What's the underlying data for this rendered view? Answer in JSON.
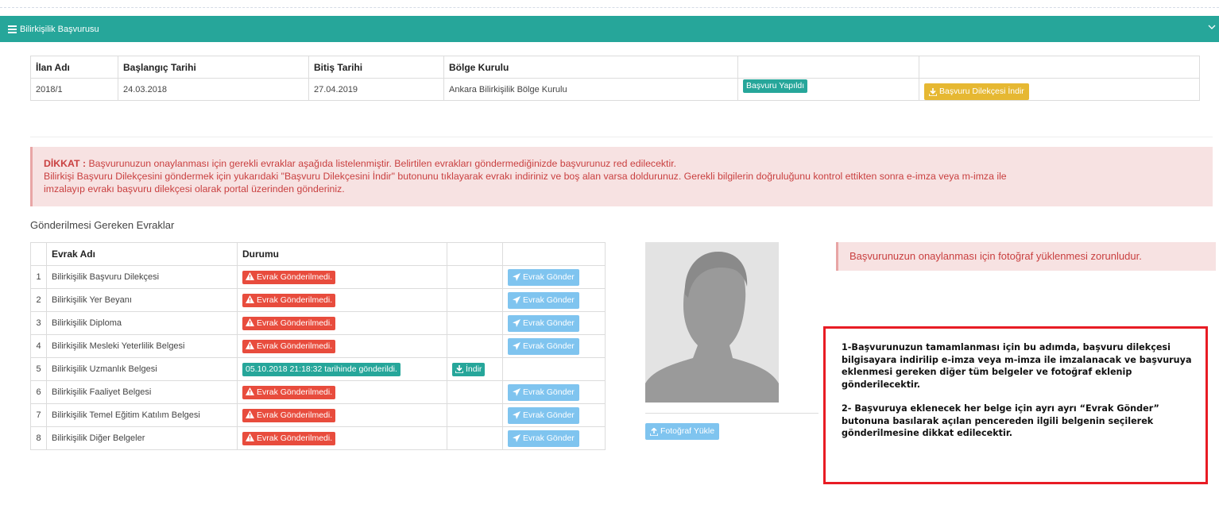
{
  "panel": {
    "title": "Bilirkişilik Başvurusu"
  },
  "application_table": {
    "headers": [
      "İlan Adı",
      "Başlangıç Tarihi",
      "Bitiş Tarihi",
      "Bölge Kurulu",
      "",
      ""
    ],
    "row": {
      "ilan_adi": "2018/1",
      "baslangic": "24.03.2018",
      "bitis": "27.04.2019",
      "bolge": "Ankara Bilirkişilik Bölge Kurulu",
      "status_badge": "Başvuru Yapıldı",
      "download_button": "Başvuru Dilekçesi İndir"
    }
  },
  "alert": {
    "label": "DİKKAT :",
    "line1": " Başvurunuzun onaylanması için gerekli evraklar aşağıda listelenmiştir. Belirtilen evrakları göndermediğinizde başvurunuz red edilecektir.",
    "line2": "Bilirkişi Başvuru Dilekçesini göndermek için yukarıdaki \"Başvuru Dilekçesini İndir\" butonunu tıklayarak evrakı indiriniz ve boş alan varsa doldurunuz. Gerekli bilgilerin doğruluğunu kontrol ettikten sonra e-imza veya m-imza ile",
    "line3": "imzalayıp evrakı başvuru dilekçesi olarak portal üzerinden gönderiniz."
  },
  "documents": {
    "title": "Gönderilmesi Gereken Evraklar",
    "headers": {
      "name": "Evrak Adı",
      "status": "Durumu"
    },
    "rows": [
      {
        "no": "1",
        "name": "Bilirkişilik Başvuru Dilekçesi",
        "status": "Evrak Gönderilmedi.",
        "sent": false,
        "action": "Evrak Gönder"
      },
      {
        "no": "2",
        "name": "Bilirkişilik Yer Beyanı",
        "status": "Evrak Gönderilmedi.",
        "sent": false,
        "action": "Evrak Gönder"
      },
      {
        "no": "3",
        "name": "Bilirkişilik Diploma",
        "status": "Evrak Gönderilmedi.",
        "sent": false,
        "action": "Evrak Gönder"
      },
      {
        "no": "4",
        "name": "Bilirkişilik Mesleki Yeterlilik Belgesi",
        "status": "Evrak Gönderilmedi.",
        "sent": false,
        "action": "Evrak Gönder"
      },
      {
        "no": "5",
        "name": "Bilirkişilik Uzmanlık Belgesi",
        "status": "05.10.2018 21:18:32 tarihinde gönderildi.",
        "sent": true,
        "download": "İndir"
      },
      {
        "no": "6",
        "name": "Bilirkişilik Faaliyet Belgesi",
        "status": "Evrak Gönderilmedi.",
        "sent": false,
        "action": "Evrak Gönder"
      },
      {
        "no": "7",
        "name": "Bilirkişilik Temel Eğitim Katılım Belgesi",
        "status": "Evrak Gönderilmedi.",
        "sent": false,
        "action": "Evrak Gönder"
      },
      {
        "no": "8",
        "name": "Bilirkişilik Diğer Belgeler",
        "status": "Evrak Gönderilmedi.",
        "sent": false,
        "action": "Evrak Gönder"
      }
    ]
  },
  "photo": {
    "upload_button": "Fotoğraf Yükle",
    "alert": "Başvurunuzun onaylanması için fotoğraf yüklenmesi zorunludur."
  },
  "note": {
    "p1": "1-Başvurunuzun tamamlanması için bu adımda, başvuru dilekçesi bilgisayara indirilip e-imza veya m-imza ile imzalanacak ve başvuruya eklenmesi gereken diğer tüm belgeler ve fotoğraf eklenip gönderilecektir.",
    "p2": "2- Başvuruya eklenecek her belge için ayrı ayrı “Evrak Gönder” butonuna basılarak açılan pencereden ilgili belgenin seçilerek gönderilmesine dikkat edilecektir."
  },
  "colors": {
    "teal": "#26a69a",
    "danger": "#e84c3d",
    "warning": "#e6b832",
    "info": "#7fc4ef",
    "highlight_border": "#e81c24"
  }
}
